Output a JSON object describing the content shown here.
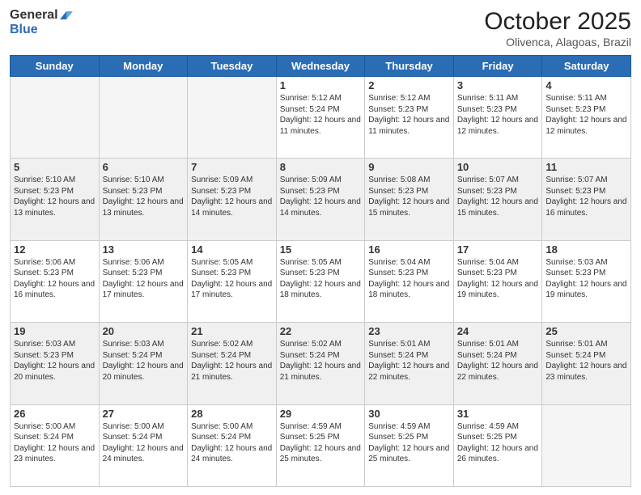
{
  "logo": {
    "line1": "General",
    "line2": "Blue"
  },
  "header": {
    "month": "October 2025",
    "location": "Olivenca, Alagoas, Brazil"
  },
  "weekdays": [
    "Sunday",
    "Monday",
    "Tuesday",
    "Wednesday",
    "Thursday",
    "Friday",
    "Saturday"
  ],
  "weeks": [
    [
      {
        "day": "",
        "empty": true
      },
      {
        "day": "",
        "empty": true
      },
      {
        "day": "",
        "empty": true
      },
      {
        "day": "1",
        "text": "Sunrise: 5:12 AM\nSunset: 5:24 PM\nDaylight: 12 hours\nand 11 minutes."
      },
      {
        "day": "2",
        "text": "Sunrise: 5:12 AM\nSunset: 5:23 PM\nDaylight: 12 hours\nand 11 minutes."
      },
      {
        "day": "3",
        "text": "Sunrise: 5:11 AM\nSunset: 5:23 PM\nDaylight: 12 hours\nand 12 minutes."
      },
      {
        "day": "4",
        "text": "Sunrise: 5:11 AM\nSunset: 5:23 PM\nDaylight: 12 hours\nand 12 minutes."
      }
    ],
    [
      {
        "day": "5",
        "text": "Sunrise: 5:10 AM\nSunset: 5:23 PM\nDaylight: 12 hours\nand 13 minutes."
      },
      {
        "day": "6",
        "text": "Sunrise: 5:10 AM\nSunset: 5:23 PM\nDaylight: 12 hours\nand 13 minutes."
      },
      {
        "day": "7",
        "text": "Sunrise: 5:09 AM\nSunset: 5:23 PM\nDaylight: 12 hours\nand 14 minutes."
      },
      {
        "day": "8",
        "text": "Sunrise: 5:09 AM\nSunset: 5:23 PM\nDaylight: 12 hours\nand 14 minutes."
      },
      {
        "day": "9",
        "text": "Sunrise: 5:08 AM\nSunset: 5:23 PM\nDaylight: 12 hours\nand 15 minutes."
      },
      {
        "day": "10",
        "text": "Sunrise: 5:07 AM\nSunset: 5:23 PM\nDaylight: 12 hours\nand 15 minutes."
      },
      {
        "day": "11",
        "text": "Sunrise: 5:07 AM\nSunset: 5:23 PM\nDaylight: 12 hours\nand 16 minutes."
      }
    ],
    [
      {
        "day": "12",
        "text": "Sunrise: 5:06 AM\nSunset: 5:23 PM\nDaylight: 12 hours\nand 16 minutes."
      },
      {
        "day": "13",
        "text": "Sunrise: 5:06 AM\nSunset: 5:23 PM\nDaylight: 12 hours\nand 17 minutes."
      },
      {
        "day": "14",
        "text": "Sunrise: 5:05 AM\nSunset: 5:23 PM\nDaylight: 12 hours\nand 17 minutes."
      },
      {
        "day": "15",
        "text": "Sunrise: 5:05 AM\nSunset: 5:23 PM\nDaylight: 12 hours\nand 18 minutes."
      },
      {
        "day": "16",
        "text": "Sunrise: 5:04 AM\nSunset: 5:23 PM\nDaylight: 12 hours\nand 18 minutes."
      },
      {
        "day": "17",
        "text": "Sunrise: 5:04 AM\nSunset: 5:23 PM\nDaylight: 12 hours\nand 19 minutes."
      },
      {
        "day": "18",
        "text": "Sunrise: 5:03 AM\nSunset: 5:23 PM\nDaylight: 12 hours\nand 19 minutes."
      }
    ],
    [
      {
        "day": "19",
        "text": "Sunrise: 5:03 AM\nSunset: 5:23 PM\nDaylight: 12 hours\nand 20 minutes."
      },
      {
        "day": "20",
        "text": "Sunrise: 5:03 AM\nSunset: 5:24 PM\nDaylight: 12 hours\nand 20 minutes."
      },
      {
        "day": "21",
        "text": "Sunrise: 5:02 AM\nSunset: 5:24 PM\nDaylight: 12 hours\nand 21 minutes."
      },
      {
        "day": "22",
        "text": "Sunrise: 5:02 AM\nSunset: 5:24 PM\nDaylight: 12 hours\nand 21 minutes."
      },
      {
        "day": "23",
        "text": "Sunrise: 5:01 AM\nSunset: 5:24 PM\nDaylight: 12 hours\nand 22 minutes."
      },
      {
        "day": "24",
        "text": "Sunrise: 5:01 AM\nSunset: 5:24 PM\nDaylight: 12 hours\nand 22 minutes."
      },
      {
        "day": "25",
        "text": "Sunrise: 5:01 AM\nSunset: 5:24 PM\nDaylight: 12 hours\nand 23 minutes."
      }
    ],
    [
      {
        "day": "26",
        "text": "Sunrise: 5:00 AM\nSunset: 5:24 PM\nDaylight: 12 hours\nand 23 minutes."
      },
      {
        "day": "27",
        "text": "Sunrise: 5:00 AM\nSunset: 5:24 PM\nDaylight: 12 hours\nand 24 minutes."
      },
      {
        "day": "28",
        "text": "Sunrise: 5:00 AM\nSunset: 5:24 PM\nDaylight: 12 hours\nand 24 minutes."
      },
      {
        "day": "29",
        "text": "Sunrise: 4:59 AM\nSunset: 5:25 PM\nDaylight: 12 hours\nand 25 minutes."
      },
      {
        "day": "30",
        "text": "Sunrise: 4:59 AM\nSunset: 5:25 PM\nDaylight: 12 hours\nand 25 minutes."
      },
      {
        "day": "31",
        "text": "Sunrise: 4:59 AM\nSunset: 5:25 PM\nDaylight: 12 hours\nand 26 minutes."
      },
      {
        "day": "",
        "empty": true
      }
    ]
  ]
}
